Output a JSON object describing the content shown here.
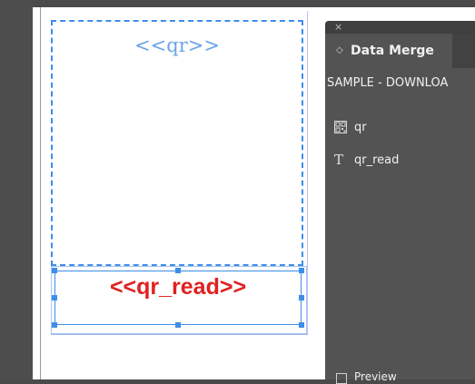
{
  "document": {
    "qr_placeholder": "<<qr>>",
    "qr_read_placeholder": "<<qr_read>>"
  },
  "panel": {
    "close_glyph": "×",
    "tab_label": "Data Merge",
    "tab_chevron": "◇",
    "source_name": "SAMPLE - DOWNLOA",
    "fields": [
      {
        "label": "qr",
        "icon": "qr-code-icon"
      },
      {
        "label": "qr_read",
        "icon": "text-type-icon",
        "glyph": "T"
      }
    ],
    "preview_label": "Preview"
  },
  "colors": {
    "frame_blue": "#3d8ee8",
    "qr_text": "#6aa4e8",
    "read_text": "#e02020",
    "panel_bg": "#535353"
  }
}
